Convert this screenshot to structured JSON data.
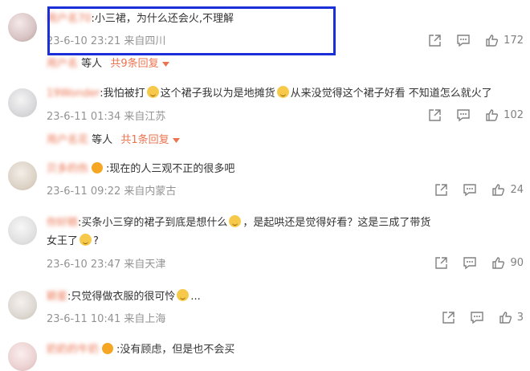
{
  "comments": [
    {
      "user": "用户名70",
      "text": ":小三裙，为什么还会火,不理解",
      "date": "23-6-10 23:21",
      "location": "来自四川",
      "likes": "172",
      "replies": {
        "names": "用户名",
        "suffix": "等人",
        "count": "共9条回复"
      }
    },
    {
      "user": "19Wonder",
      "text": ":我怕被打",
      "text_mid": "这个裙子我以为是地摊货",
      "text_end": "从来没觉得这个裙子好看 不知道怎么就火了",
      "date": "23-6-11 01:34",
      "location": "来自江苏",
      "likes": "102",
      "replies": {
        "names": "用户名花",
        "suffix": "等人",
        "count": "共1条回复"
      }
    },
    {
      "user": "贝多的伤",
      "text": ":现在的人三观不正的很多吧",
      "date": "23-6-11 09:22",
      "location": "来自内蒙古",
      "likes": "24"
    },
    {
      "user": "你好糕",
      "text": ":买条小三穿的裙子到底是想什么",
      "text_mid": "，是起哄还是觉得好看？这是三成了带货",
      "line2": "女王了",
      "line2_end": "?",
      "date": "23-6-10 23:47",
      "location": "来自天津",
      "likes": "90"
    },
    {
      "user": "颖星",
      "text": ":只觉得做衣服的很可怜",
      "text_end": "...",
      "date": "23-6-11 10:41",
      "location": "来自上海",
      "likes": "3"
    },
    {
      "user": "奶奶的牛奶",
      "text": ":没有顾虑，但是也不会买"
    }
  ],
  "icons": {
    "share": "share-icon",
    "comment": "comment-icon",
    "like": "thumbs-up-icon",
    "caret": "caret-down-icon"
  },
  "colors": {
    "accent": "#eb7350",
    "highlight": "#1a2fd8",
    "meta": "#939393"
  }
}
